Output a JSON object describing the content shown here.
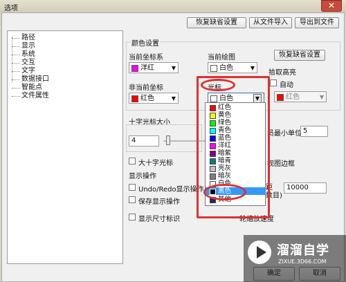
{
  "window": {
    "title": "选项",
    "close_label": "✕"
  },
  "top_buttons": {
    "restore_defaults": "恢复缺省设置",
    "import": "从文件导入",
    "export": "导出到文件"
  },
  "tree": {
    "items": [
      "路径",
      "显示",
      "系统",
      "交互",
      "文字",
      "数据接口",
      "智能点",
      "文件属性"
    ]
  },
  "colors": {
    "section_title": "颜色设置",
    "current_coord": {
      "label": "当前坐标系",
      "value": "洋红",
      "swatch": "#ff00ff"
    },
    "current_plot": {
      "label": "当前绘图",
      "value": "白色",
      "swatch": "#ffffff"
    },
    "restore_defaults": "恢复缺省设置",
    "noncurrent_coord": {
      "label": "非当前坐标",
      "value": "红色",
      "swatch": "#ff0000"
    },
    "cursor": {
      "label": "光标",
      "value": "白色",
      "swatch": "#ffffff"
    },
    "pick_highlight": {
      "label": "拾取高亮",
      "value": "红色",
      "swatch": "#ff0000"
    },
    "auto_label": "自动"
  },
  "cursor_dropdown": {
    "options": [
      {
        "label": "红色",
        "color": "#ff0000"
      },
      {
        "label": "黄色",
        "color": "#ffff00"
      },
      {
        "label": "绿色",
        "color": "#00ff00"
      },
      {
        "label": "青色",
        "color": "#00ffff"
      },
      {
        "label": "蓝色",
        "color": "#0000ff"
      },
      {
        "label": "洋红",
        "color": "#ff00ff"
      },
      {
        "label": "暗紫",
        "color": "#800080"
      },
      {
        "label": "暗青",
        "color": "#008080"
      },
      {
        "label": "亮灰",
        "color": "#c0c0c0"
      },
      {
        "label": "暗灰",
        "color": "#808080"
      },
      {
        "label": "白色",
        "color": "#ffffff"
      },
      {
        "label": "黑色",
        "color": "#000000"
      },
      {
        "label": "其他",
        "color": "#1e2a60"
      }
    ],
    "highlighted_option": "黑色"
  },
  "cursor_size": {
    "title": "十字光标大小",
    "value": "4",
    "slider_level": 0.04
  },
  "unit": {
    "label_fragment": "员最小单位",
    "value": "5"
  },
  "big_cursor": {
    "label": "大十字光标"
  },
  "viewport_border": {
    "label_fragment": "视图边框"
  },
  "display_ops": {
    "title": "显示操作",
    "undo_redo": "Undo/Redo显示操作",
    "save_display": "保存显示操作",
    "distance_label_fragment_1": "距",
    "distance_label_fragment_2": "数目)",
    "distance_value": "10000"
  },
  "size_marks": {
    "label": "显示尺寸标识"
  },
  "scale_speed": {
    "label_fragment": "轮缩放速度"
  },
  "bottom_buttons": {
    "ok": "确定",
    "cancel": "取消"
  },
  "watermark": {
    "title": "溜溜自学",
    "subtitle": "ZIXUE.3D66.COM"
  },
  "annotation_colors": {
    "red_marker": "#e03030",
    "selection": "#3399ff"
  }
}
